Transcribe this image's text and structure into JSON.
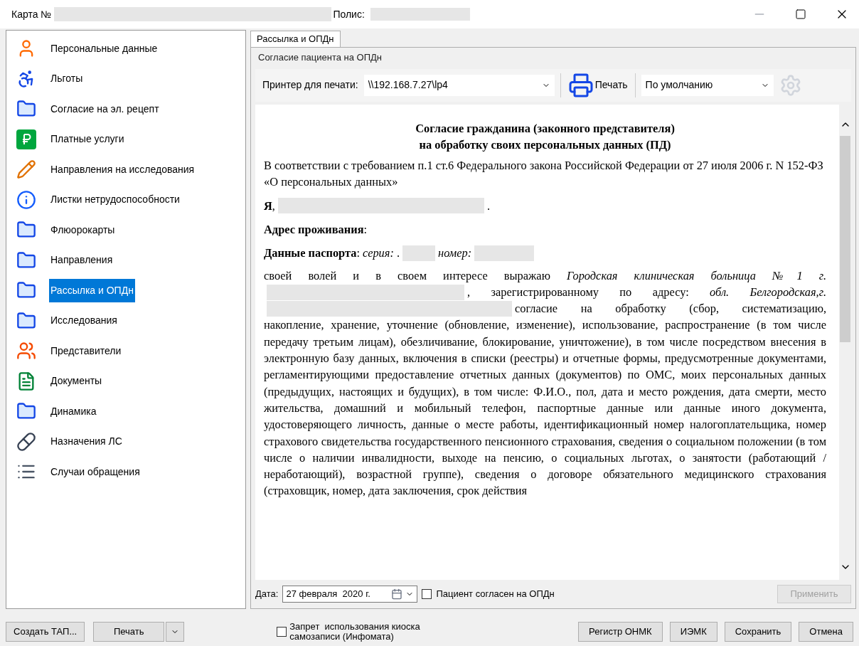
{
  "window": {
    "card_label": "Карта №",
    "policy_label": "Полис:"
  },
  "sidebar": {
    "items": [
      {
        "label": "Персональные данные",
        "kind": "person",
        "selected": false
      },
      {
        "label": "Льготы",
        "kind": "wheelchair",
        "selected": false
      },
      {
        "label": "Согласие на эл. рецепт",
        "kind": "folder",
        "selected": false
      },
      {
        "label": "Платные услуги",
        "kind": "ruble",
        "selected": false
      },
      {
        "label": "Направления на исследования",
        "kind": "pencil",
        "selected": false
      },
      {
        "label": "Листки нетрудоспособности",
        "kind": "info",
        "selected": false
      },
      {
        "label": "Флюорокарты",
        "kind": "folder",
        "selected": false
      },
      {
        "label": "Направления",
        "kind": "folder",
        "selected": false
      },
      {
        "label": "Рассылка и ОПДн",
        "kind": "folder",
        "selected": true
      },
      {
        "label": "Исследования",
        "kind": "folder",
        "selected": false
      },
      {
        "label": "Представители",
        "kind": "people",
        "selected": false
      },
      {
        "label": "Документы",
        "kind": "document",
        "selected": false
      },
      {
        "label": "Динамика",
        "kind": "folder",
        "selected": false
      },
      {
        "label": "Назначения ЛС",
        "kind": "pills",
        "selected": false
      },
      {
        "label": "Случаи обращения",
        "kind": "list",
        "selected": false
      }
    ]
  },
  "tabs": [
    {
      "label": "Рассылка и ОПДн",
      "selected": true
    }
  ],
  "group": {
    "title": "Согласие пациента на ОПДн",
    "toolbar": {
      "printer_label": "Принтер для печати:",
      "printer_value": "\\\\192.168.7.27\\lp4",
      "print_button": "Печать",
      "template_value": "По умолчанию"
    },
    "document": {
      "title_lines": [
        "Согласие гражданина (законного представителя)",
        "на обработку своих персональных данных (ПД)"
      ],
      "intro": "В соответствии с требованием п.1 ст.6 Федерального закона Российской Федерации от 27 июля 2006 г. N 152-ФЗ «О персональных данных»",
      "fields": [
        {
          "segments": [
            {
              "kind": "text",
              "text": "**Я**,"
            },
            {
              "kind": "redacted"
            },
            {
              "kind": "text",
              "text": "."
            }
          ]
        },
        {
          "segments": [
            {
              "kind": "text",
              "text": "**Адрес проживания**:"
            }
          ]
        },
        {
          "segments": [
            {
              "kind": "text",
              "text": "**Данные паспорта**: *серия:* ."
            },
            {
              "kind": "redacted"
            },
            {
              "kind": "text",
              "text": "*номер:*"
            },
            {
              "kind": "redacted"
            }
          ]
        }
      ],
      "body_lines": [
        {
          "segments": [
            {
              "kind": "text",
              "text": "своей волей и в своем интересе выражаю *Городская клиническая больница №1 г.*"
            }
          ]
        },
        {
          "segments": [
            {
              "kind": "redacted"
            },
            {
              "kind": "text",
              "text": ", зарегистрированному по адресу: *обл. Белгородская,г.*"
            }
          ]
        },
        {
          "segments": [
            {
              "kind": "redacted"
            },
            {
              "kind": "text",
              "text": "согласие на обработку (сбор, систематизацию,"
            }
          ]
        }
      ],
      "body_rest": "накопление, хранение, уточнение (обновление, изменение), использование, распространение (в том числе передачу третьим лицам), обезличивание, блокирование, уничтожение), в том числе посредством внесения в электронную базу данных, включения в списки (реестры) и отчетные формы, предусмотренные документами, регламентирующими предоставление отчетных данных (документов) по ОМС, моих персональных данных (предыдущих, настоящих и будущих), в том числе: Ф.И.О., пол, дата и место рождения, дата смерти, место жительства, домашний и мобильный телефон, паспортные данные или данные иного документа, удостоверяющего личность, данные о месте работы, идентификационный номер налогоплательщика, номер страхового свидетельства государственного пенсионного страхования, сведения о социальном положении (в том числе о наличии инвалидности, выходе на пенсию, о социальных льготах, о занятости (работающий / неработающий), возрастной группе), сведения о договоре обязательного медицинского страхования (страховщик, номер, дата заключения, срок действия"
    },
    "footer": {
      "date_label": "Дата:",
      "date_value": "27 февраля  2020 г.",
      "consent_label": "Пациент согласен на ОПДн",
      "consent_checked": false,
      "apply_button": "Применить",
      "apply_disabled": true
    }
  },
  "bottom_bar": {
    "create_button": "Создать ТАП...",
    "print_button": "Печать",
    "kiosk_label": "Запрет  использования киоска самозаписи (Инфомата)",
    "kiosk_checked": false,
    "buttons": [
      "Регистр ОНМК",
      "ИЭМК",
      "Сохранить",
      "Отмена"
    ]
  }
}
